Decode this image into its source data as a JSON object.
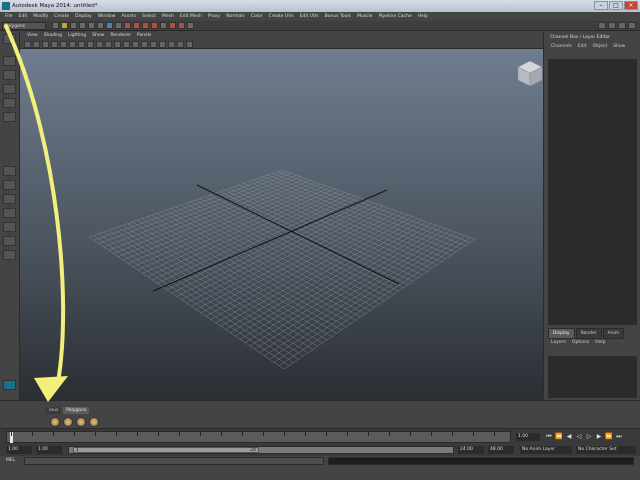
{
  "window": {
    "title": "Autodesk Maya 2014: untitled*",
    "buttons": [
      "–",
      "□",
      "×"
    ]
  },
  "menubar": {
    "items": [
      "File",
      "Edit",
      "Modify",
      "Create",
      "Display",
      "Window",
      "Assets",
      "Select",
      "Mesh",
      "Edit Mesh",
      "Proxy",
      "Normals",
      "Color",
      "Create UVs",
      "Edit UVs",
      "Bonus Tools",
      "Muscle",
      "Pipeline Cache",
      "Help"
    ]
  },
  "statusline": {
    "mode": "Polygons"
  },
  "panel": {
    "menu": [
      "View",
      "Shading",
      "Lighting",
      "Show",
      "Renderer",
      "Panels"
    ]
  },
  "channelbox": {
    "title": "Channel Box / Layer Editor",
    "tabs": [
      "Channels",
      "Edit",
      "Object",
      "Show"
    ]
  },
  "layers": {
    "tabs": [
      "Display",
      "Render",
      "Anim"
    ],
    "menu": [
      "Layers",
      "Options",
      "Help"
    ]
  },
  "shelf": {
    "tabs": [
      "ious",
      "Polygons"
    ]
  },
  "timeslider": {
    "current_frame": "1.00"
  },
  "rangeslider": {
    "start": "1.00",
    "start2": "1.00",
    "range_start_label": "1",
    "range_end_label": "24",
    "end": "24.00",
    "end2": "48.00",
    "anim_layer": "No Anim Layer",
    "char_set": "No Character Set"
  },
  "cmdline": {
    "label": "MEL"
  },
  "colors": {
    "annotation_arrow": "#f2f07a",
    "viewport_top": "#6f7d8f",
    "viewport_bottom": "#2b2e33"
  }
}
